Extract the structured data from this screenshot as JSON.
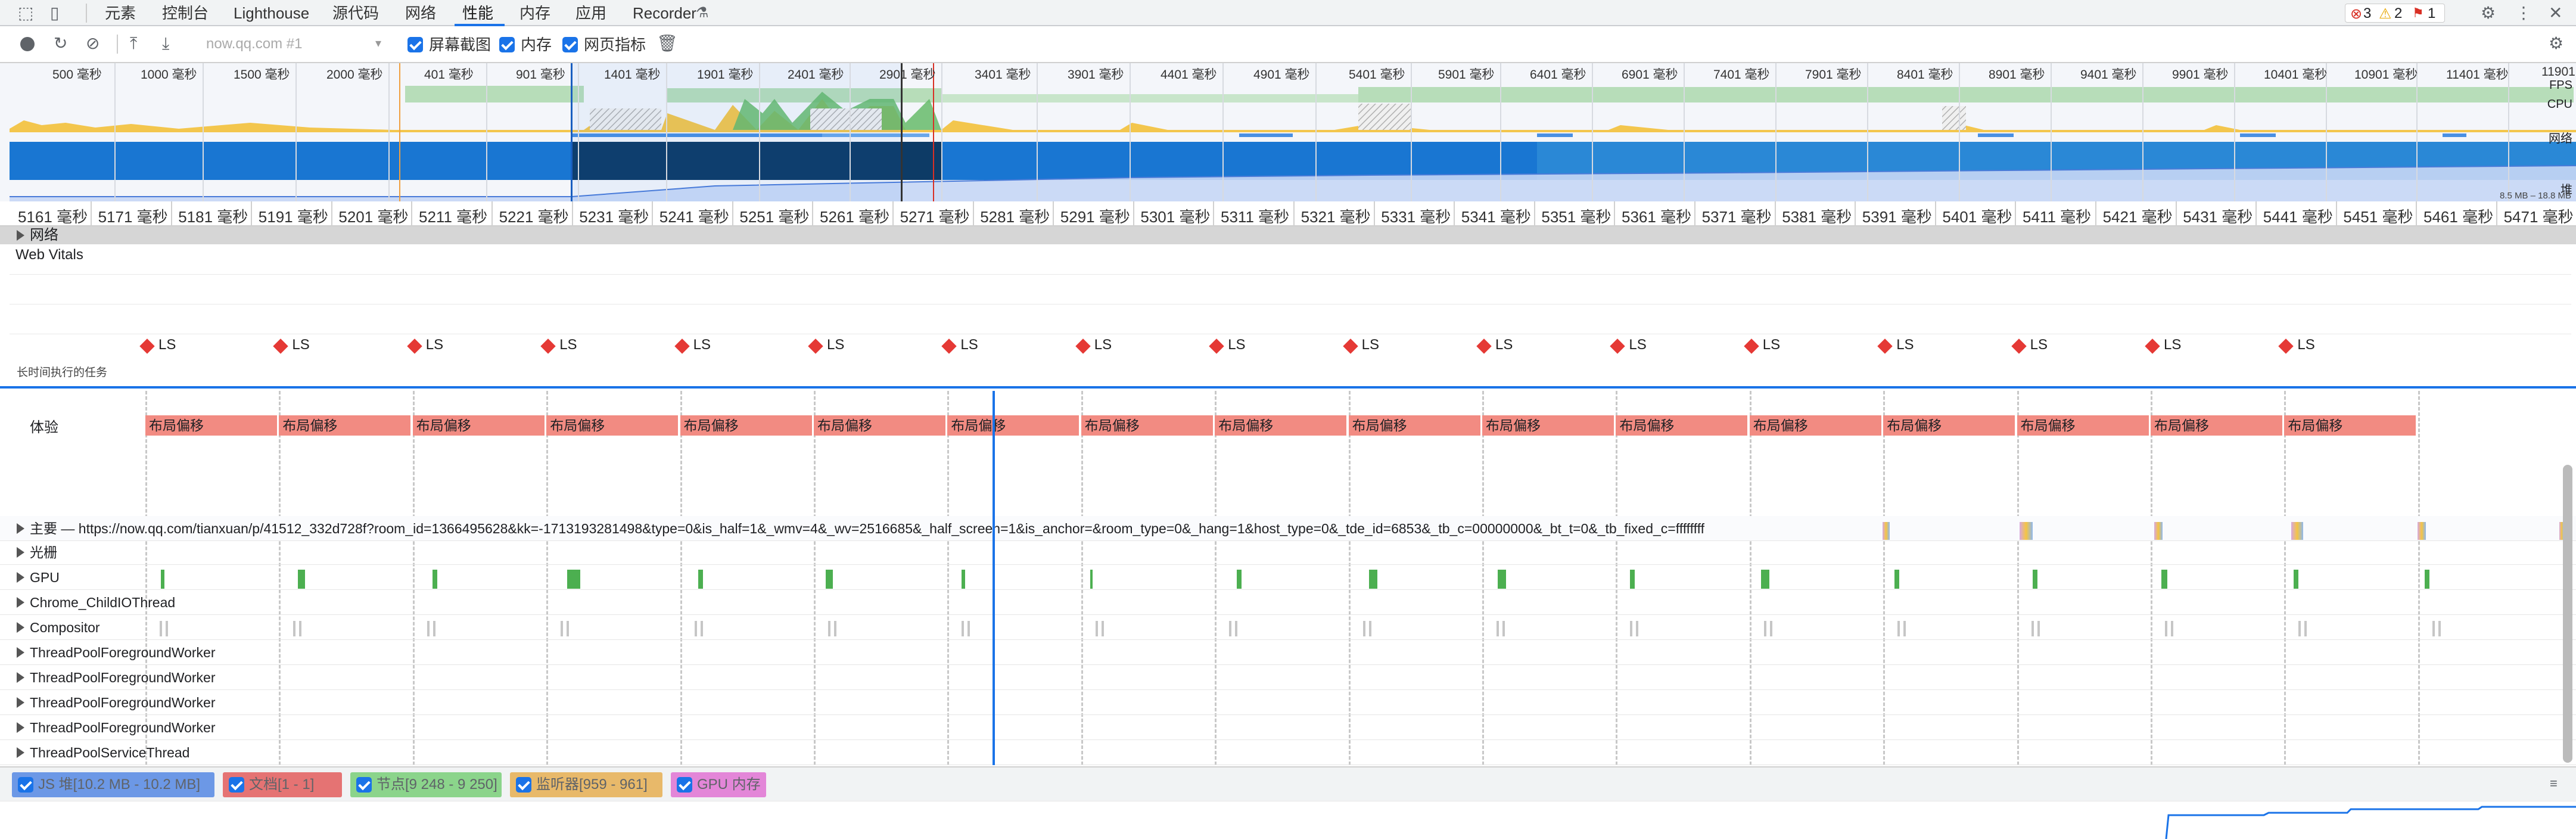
{
  "tabs": [
    "元素",
    "控制台",
    "Lighthouse",
    "源代码",
    "网络",
    "性能",
    "内存",
    "应用",
    "Recorder"
  ],
  "active_tab": "性能",
  "badges": {
    "errors": "3",
    "warnings": "2",
    "issues": "1"
  },
  "toolbar": {
    "recording_select": "now.qq.com #1",
    "screenshots_label": "屏幕截图",
    "memory_label": "内存",
    "webvitals_label": "网页指标"
  },
  "overview": {
    "times": [
      "500 毫秒",
      "1000 毫秒",
      "1500 毫秒",
      "2000 毫秒",
      "401 毫秒",
      "901 毫秒",
      "1401 毫秒",
      "1901 毫秒",
      "2401 毫秒",
      "2901 毫秒",
      "3401 毫秒",
      "3901 毫秒",
      "4401 毫秒",
      "4901 毫秒",
      "5401 毫秒",
      "5901 毫秒",
      "6401 毫秒",
      "6901 毫秒",
      "7401 毫秒",
      "7901 毫秒",
      "8401 毫秒",
      "8901 毫秒",
      "9401 毫秒",
      "9901 毫秒",
      "10401 毫秒",
      "10901 毫秒",
      "11401 毫秒",
      "11901"
    ],
    "fps_label": "FPS",
    "cpu_label": "CPU",
    "net_label": "网络",
    "heap_label": "堆",
    "heap_range": "8.5 MB – 18.8 MB"
  },
  "ruler": [
    "5161 毫秒",
    "5171 毫秒",
    "5181 毫秒",
    "5191 毫秒",
    "5201 毫秒",
    "5211 毫秒",
    "5221 毫秒",
    "5231 毫秒",
    "5241 毫秒",
    "5251 毫秒",
    "5261 毫秒",
    "5271 毫秒",
    "5281 毫秒",
    "5291 毫秒",
    "5301 毫秒",
    "5311 毫秒",
    "5321 毫秒",
    "5331 毫秒",
    "5341 毫秒",
    "5351 毫秒",
    "5361 毫秒",
    "5371 毫秒",
    "5381 毫秒",
    "5391 毫秒",
    "5401 毫秒",
    "5411 毫秒",
    "5421 毫秒",
    "5431 毫秒",
    "5441 毫秒",
    "5451 毫秒",
    "5461 毫秒",
    "5471 毫秒"
  ],
  "sections": {
    "network": "网络",
    "webvitals": "Web Vitals",
    "ls": "LS",
    "long_tasks": "长时间执行的任务",
    "experience": "体验",
    "layout_shift": "布局偏移"
  },
  "tracks": [
    "主要 — https://now.qq.com/tianxuan/p/41512_332d728f?room_id=1366495628&kk=-1713193281498&type=0&is_half=1&_wmv=4&_wv=2516685&_half_screen=1&is_anchor=&room_type=0&_hang=1&host_type=0&_tde_id=6853&_tb_c=00000000&_bt_t=0&_tb_fixed_c=ffffffff",
    "光栅",
    "GPU",
    "Chrome_ChildIOThread",
    "Compositor",
    "ThreadPoolForegroundWorker",
    "ThreadPoolForegroundWorker",
    "ThreadPoolForegroundWorker",
    "ThreadPoolForegroundWorker",
    "ThreadPoolServiceThread"
  ],
  "legend": [
    {
      "label": "JS 堆[10.2 MB - 10.2 MB]",
      "color": "#6c98e6"
    },
    {
      "label": "文档[1 - 1]",
      "color": "#e57373"
    },
    {
      "label": "节点[9 248 - 9 250]",
      "color": "#8bd48b"
    },
    {
      "label": "监听器[959 - 961]",
      "color": "#e8b96a"
    },
    {
      "label": "GPU 内存",
      "color": "#e386d8"
    }
  ]
}
